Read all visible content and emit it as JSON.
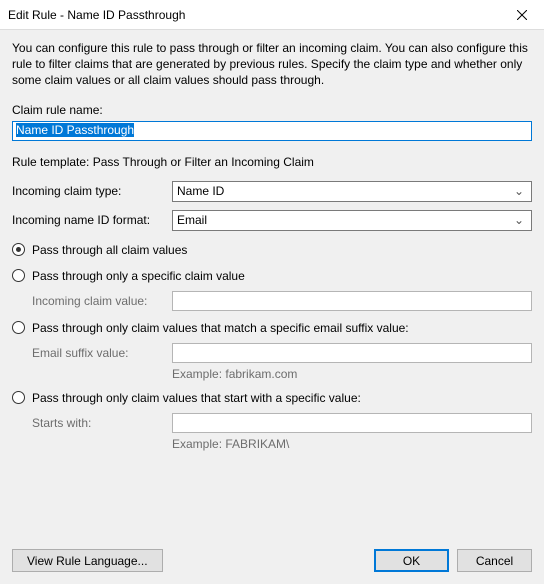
{
  "window": {
    "title": "Edit Rule - Name ID Passthrough"
  },
  "description": "You can configure this rule to pass through or filter an incoming claim. You can also configure this rule to filter claims that are generated by previous rules. Specify the claim type and whether only some claim values or all claim values should pass through.",
  "ruleName": {
    "label": "Claim rule name:",
    "value": "Name ID Passthrough"
  },
  "templateLine": "Rule template: Pass Through or Filter an Incoming Claim",
  "incomingType": {
    "label": "Incoming claim type:",
    "value": "Name ID"
  },
  "nameIdFormat": {
    "label": "Incoming name ID format:",
    "value": "Email"
  },
  "options": {
    "all": "Pass through all claim values",
    "specific": "Pass through only a specific claim value",
    "specificLabel": "Incoming claim value:",
    "emailSuffix": "Pass through only claim values that match a specific email suffix value:",
    "emailSuffixLabel": "Email suffix value:",
    "emailSuffixExample": "Example: fabrikam.com",
    "startsWith": "Pass through only claim values that start with a specific value:",
    "startsWithLabel": "Starts with:",
    "startsWithExample": "Example: FABRIKAM\\"
  },
  "buttons": {
    "viewLang": "View Rule Language...",
    "ok": "OK",
    "cancel": "Cancel"
  }
}
